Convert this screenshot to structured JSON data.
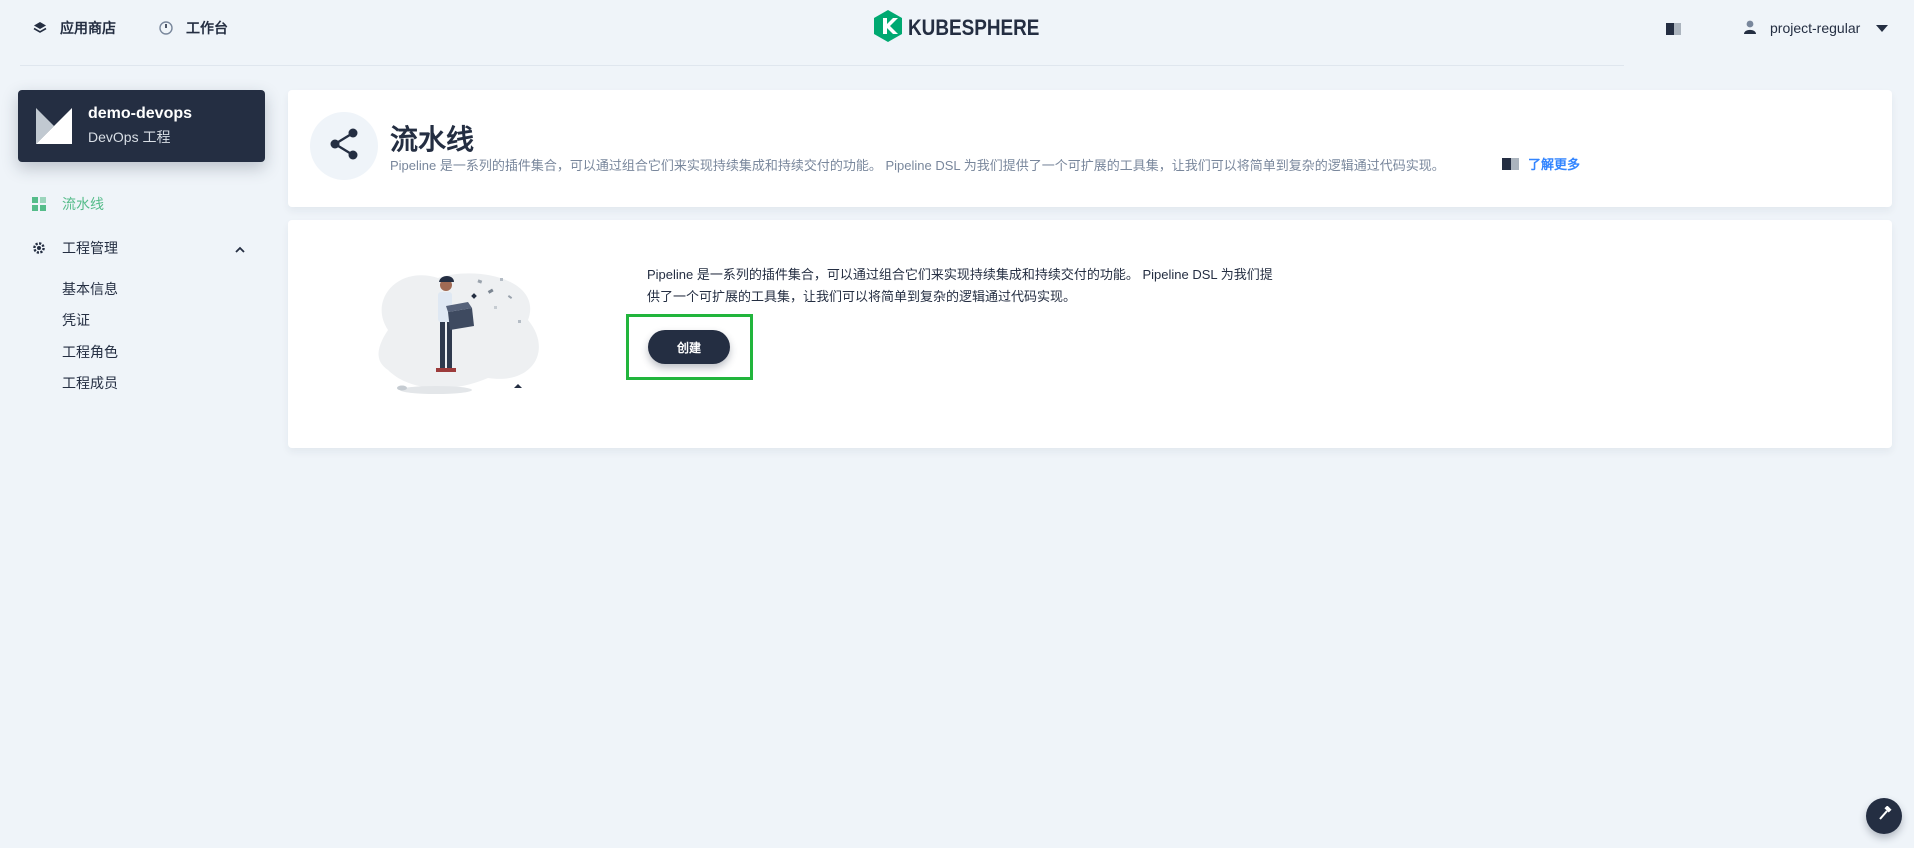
{
  "header": {
    "app_store_label": "应用商店",
    "workbench_label": "工作台",
    "brand": "KUBESPHERE",
    "username": "project-regular"
  },
  "sidebar": {
    "project_name": "demo-devops",
    "project_type": "DevOps 工程",
    "pipeline_label": "流水线",
    "management_label": "工程管理",
    "sub_items": [
      "基本信息",
      "凭证",
      "工程角色",
      "工程成员"
    ]
  },
  "banner": {
    "title": "流水线",
    "description": "Pipeline 是一系列的插件集合，可以通过组合它们来实现持续集成和持续交付的功能。 Pipeline DSL 为我们提供了一个可扩展的工具集，让我们可以将简单到复杂的逻辑通过代码实现。",
    "learn_more": "了解更多"
  },
  "empty_state": {
    "line1": "Pipeline 是一系列的插件集合，可以通过组合它们来实现持续集成和持续交付的功能。 Pipeline DSL 为我们提",
    "line2": "供了一个可扩展的工具集，让我们可以将简单到复杂的逻辑通过代码实现。",
    "create_button": "创建"
  },
  "colors": {
    "accent_green": "#55bc8a",
    "dark": "#242e42",
    "link_blue": "#3385ff",
    "highlight_box": "#21b53c"
  },
  "icons": {
    "app_store": "layers-icon",
    "workbench": "dashboard-icon",
    "brand": "kubesphere-logo-icon",
    "docs": "book-icon",
    "user": "user-icon",
    "pipeline": "pipeline-icon",
    "management": "gear-icon",
    "banner": "share-nodes-icon",
    "fab": "hammer-icon"
  }
}
